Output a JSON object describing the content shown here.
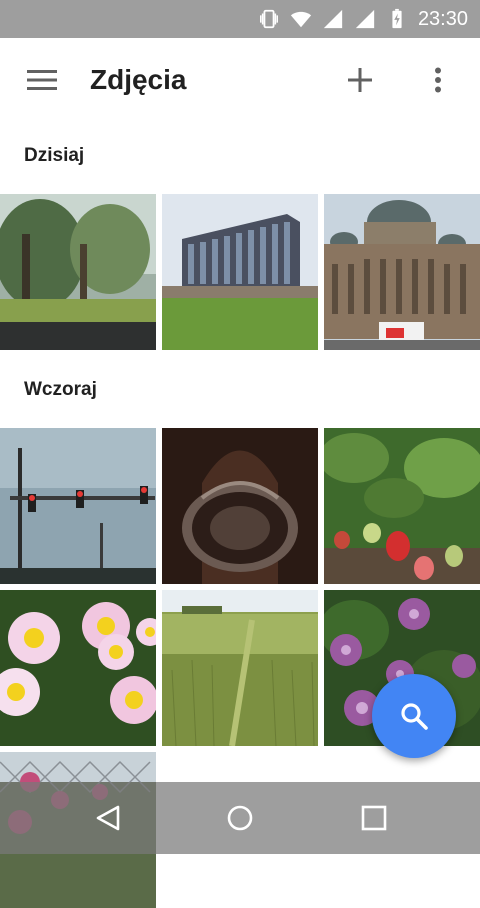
{
  "status_bar": {
    "time": "23:30",
    "icons": [
      "vibrate-icon",
      "wifi-icon",
      "cell-signal-icon",
      "cell-signal-icon",
      "battery-charging-icon"
    ]
  },
  "app_bar": {
    "title": "Zdjęcia",
    "menu_icon": "hamburger-menu-icon",
    "add_icon": "add-icon",
    "more_icon": "more-vert-icon"
  },
  "sections": [
    {
      "title": "Dzisiaj",
      "photos": [
        "trees-park-photo",
        "apartment-building-photo",
        "domed-building-photo"
      ]
    },
    {
      "title": "Wczoraj",
      "photos": [
        "traffic-lights-photo",
        "clock-photo",
        "strawberries-photo",
        "daisies-photo",
        "wheat-field-photo",
        "purple-flowers-photo",
        "fence-flowers-photo"
      ]
    }
  ],
  "fab": {
    "icon": "search-icon",
    "color": "#4285f4"
  },
  "nav_bar": {
    "buttons": [
      "back-icon",
      "home-icon",
      "recents-icon"
    ]
  },
  "colors": {
    "status_bar": "#9e9e9e",
    "accent": "#4285f4"
  }
}
